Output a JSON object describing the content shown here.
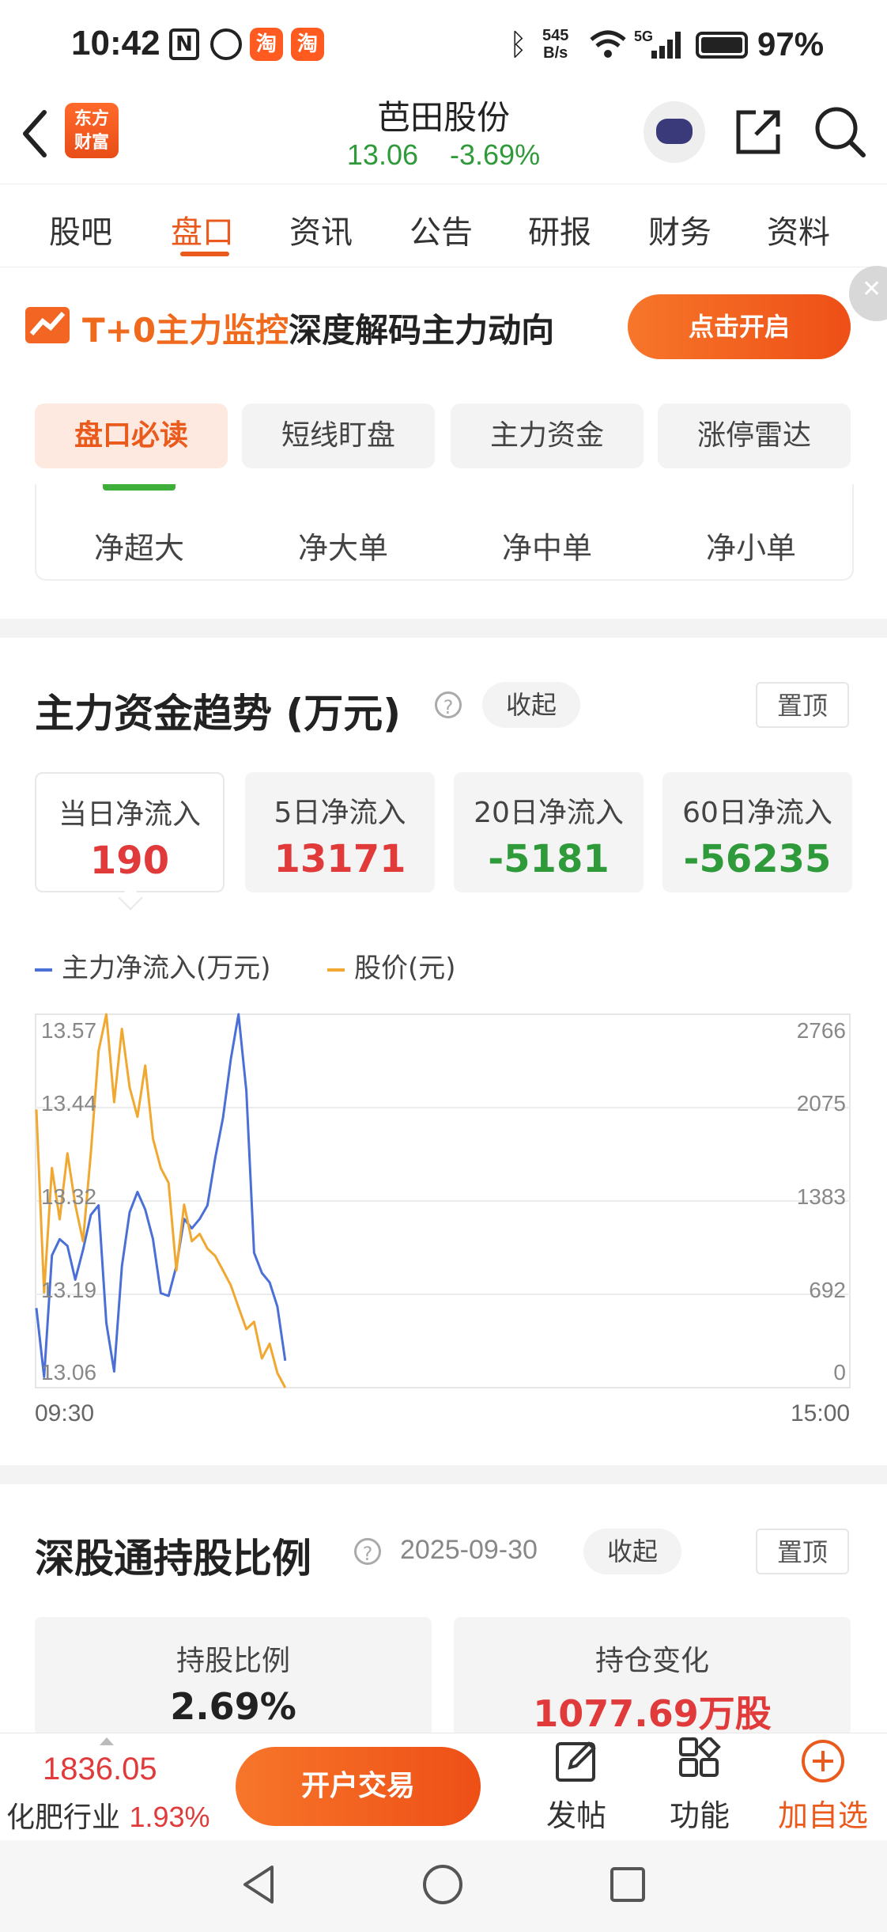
{
  "status_bar": {
    "time": "10:42",
    "net_speed_top": "545",
    "net_speed_bottom": "B/s",
    "battery": "97%",
    "taobao_label": "淘",
    "network": "5G"
  },
  "header": {
    "logo_line1": "东方",
    "logo_line2": "财富",
    "stock_name": "芭田股份",
    "price": "13.06",
    "change": "-3.69%"
  },
  "tabs": [
    "股吧",
    "盘口",
    "资讯",
    "公告",
    "研报",
    "财务",
    "资料"
  ],
  "active_tab": "盘口",
  "banner": {
    "highlight": "T+0主力监控",
    "text": "深度解码主力动向",
    "button": "点击开启"
  },
  "subtabs": [
    "盘口必读",
    "短线盯盘",
    "主力资金",
    "涨停雷达"
  ],
  "net_flow_items": [
    "净超大",
    "净大单",
    "净中单",
    "净小单"
  ],
  "trend_section": {
    "title": "主力资金趋势 (万元)",
    "collapse": "收起",
    "pin": "置顶",
    "flows": [
      {
        "label": "当日净流入",
        "value": "190",
        "color": "red"
      },
      {
        "label": "5日净流入",
        "value": "13171",
        "color": "red"
      },
      {
        "label": "20日净流入",
        "value": "-5181",
        "color": "green"
      },
      {
        "label": "60日净流入",
        "value": "-56235",
        "color": "green"
      }
    ],
    "legend": {
      "flow": "主力净流入(万元)",
      "price": "股价(元)"
    }
  },
  "chart_data": {
    "type": "line",
    "x_range": [
      "09:30",
      "15:00"
    ],
    "left_axis_ticks": [
      "13.57",
      "13.44",
      "13.32",
      "13.19",
      "13.06"
    ],
    "right_axis_ticks": [
      "2766",
      "2075",
      "1383",
      "692",
      "0"
    ],
    "series": [
      {
        "name": "主力净流入(万元)",
        "color": "#4a6fd6",
        "axis": "right",
        "values": [
          590,
          80,
          980,
          1100,
          1050,
          800,
          1020,
          1280,
          1350,
          480,
          120,
          900,
          1300,
          1450,
          1320,
          1100,
          700,
          680,
          900,
          1250,
          1180,
          1250,
          1350,
          1700,
          2000,
          2430,
          2766,
          2200,
          1000,
          850,
          780,
          600,
          200
        ]
      },
      {
        "name": "股价(元)",
        "color": "#f0a830",
        "axis": "left",
        "values": [
          13.44,
          13.19,
          13.36,
          13.29,
          13.38,
          13.31,
          13.26,
          13.38,
          13.52,
          13.57,
          13.45,
          13.55,
          13.47,
          13.43,
          13.5,
          13.4,
          13.36,
          13.34,
          13.22,
          13.31,
          13.26,
          13.27,
          13.25,
          13.24,
          13.22,
          13.2,
          13.17,
          13.14,
          13.15,
          13.1,
          13.12,
          13.08,
          13.06
        ]
      }
    ]
  },
  "hk_section": {
    "title": "深股通持股比例",
    "date": "2025-09-30",
    "collapse": "收起",
    "pin": "置顶",
    "ratio_label": "持股比例",
    "ratio_value": "2.69%",
    "change_label": "持仓变化",
    "change_value": "1077.69万股"
  },
  "bottom_bar": {
    "index_value": "1836.05",
    "index_name": "化肥行业",
    "index_change": "1.93%",
    "trade_button": "开户交易",
    "post": "发帖",
    "functions": "功能",
    "add_watch": "加自选"
  },
  "colors": {
    "accent": "#ea5a1c",
    "up": "#e03a3a",
    "down": "#2f9a3a"
  }
}
